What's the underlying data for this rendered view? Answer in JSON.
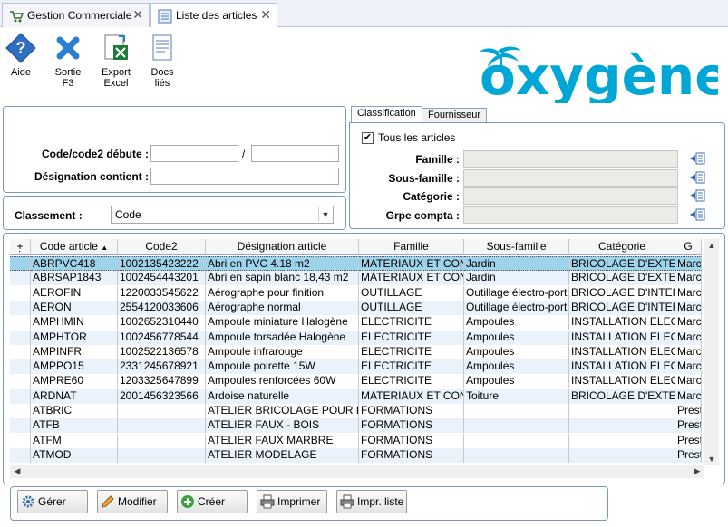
{
  "tabs": [
    {
      "label": "Gestion Commerciale",
      "active": false,
      "icon": "cart-icon"
    },
    {
      "label": "Liste des articles",
      "active": true,
      "icon": "list-icon"
    }
  ],
  "toolbar": {
    "help": {
      "label": "Aide",
      "icon": "help-icon"
    },
    "exit": {
      "label": "Sortie",
      "sub": "F3",
      "icon": "close-x-icon"
    },
    "export": {
      "label": "Export",
      "sub": "Excel",
      "icon": "excel-export-icon"
    },
    "docs": {
      "label": "Docs",
      "sub": "liés",
      "icon": "document-icon"
    }
  },
  "brand": {
    "logo_text": "oxygène",
    "color": "#00a6d6"
  },
  "filters": {
    "code_label": "Code/code2 débute :",
    "code_from": "",
    "separator": "/",
    "code_to": "",
    "designation_label": "Désignation contient :",
    "designation_value": ""
  },
  "sort": {
    "label": "Classement :",
    "value": "Code"
  },
  "classification": {
    "tabs": [
      "Classification",
      "Fournisseur"
    ],
    "active_tab": "Classification",
    "all_articles_label": "Tous les articles",
    "all_articles_checked": true,
    "famille_label": "Famille :",
    "sousfamille_label": "Sous-famille :",
    "categorie_label": "Catégorie :",
    "grpecompta_label": "Grpe compta :"
  },
  "grid": {
    "columns": [
      "Code article",
      "Code2",
      "Désignation article",
      "Famille",
      "Sous-famille",
      "Catégorie",
      "G"
    ],
    "sort_column": "Code article",
    "selected_row": 0,
    "rows": [
      [
        "ABRPVC418",
        "1002135423222",
        "Abri en PVC 4.18 m2",
        "MATERIAUX ET CONS",
        "Jardin",
        "BRICOLAGE D'EXTE",
        "Marc"
      ],
      [
        "ABRSAP1843",
        "1002454443201",
        "Abri en sapin blanc 18,43 m2",
        "MATERIAUX ET CONS",
        "Jardin",
        "BRICOLAGE D'EXTE",
        "Marc"
      ],
      [
        "AEROFIN",
        "1220033545622",
        "Aérographe pour finition",
        "OUTILLAGE",
        "Outillage électro-port",
        "BRICOLAGE D'INTER",
        "Marc"
      ],
      [
        "AERON",
        "2554120033606",
        "Aérographe normal",
        "OUTILLAGE",
        "Outillage électro-port",
        "BRICOLAGE D'INTER",
        "Marc"
      ],
      [
        "AMPHMIN",
        "1002652310440",
        "Ampoule miniature Halogène",
        "ELECTRICITE",
        "Ampoules",
        "INSTALLATION ELEC",
        "Marc"
      ],
      [
        "AMPHTOR",
        "1002456778544",
        "Ampoule torsadée Halogène",
        "ELECTRICITE",
        "Ampoules",
        "INSTALLATION ELEC",
        "Marc"
      ],
      [
        "AMPINFR",
        "1002522136578",
        "Ampoule infrarouge",
        "ELECTRICITE",
        "Ampoules",
        "INSTALLATION ELEC",
        "Marc"
      ],
      [
        "AMPPO15",
        "2331245678921",
        "Ampoule poirette 15W",
        "ELECTRICITE",
        "Ampoules",
        "INSTALLATION ELEC",
        "Marc"
      ],
      [
        "AMPRE60",
        "1203325647899",
        "Ampoules renforcées 60W",
        "ELECTRICITE",
        "Ampoules",
        "INSTALLATION ELEC",
        "Marc"
      ],
      [
        "ARDNAT",
        "2001456323566",
        "Ardoise naturelle",
        "MATERIAUX ET CONS",
        "Toiture",
        "BRICOLAGE D'EXTE",
        "Marc"
      ],
      [
        "ATBRIC",
        "",
        "ATELIER BRICOLAGE POUR D",
        "FORMATIONS",
        "",
        "",
        "Prest"
      ],
      [
        "ATFB",
        "",
        "ATELIER FAUX - BOIS",
        "FORMATIONS",
        "",
        "",
        "Prest"
      ],
      [
        "ATFM",
        "",
        "ATELIER FAUX MARBRE",
        "FORMATIONS",
        "",
        "",
        "Prest"
      ],
      [
        "ATMOD",
        "",
        "ATELIER MODELAGE",
        "FORMATIONS",
        "",
        "",
        "Prest"
      ]
    ]
  },
  "actions": {
    "manage": {
      "label": "Gérer",
      "icon": "gear-icon"
    },
    "edit": {
      "label": "Modifier",
      "icon": "pencil-icon"
    },
    "create": {
      "label": "Créer",
      "icon": "plus-circle-icon"
    },
    "print": {
      "label": "Imprimer",
      "icon": "printer-icon"
    },
    "print_list": {
      "label": "Impr. liste",
      "icon": "printer-list-icon"
    }
  }
}
